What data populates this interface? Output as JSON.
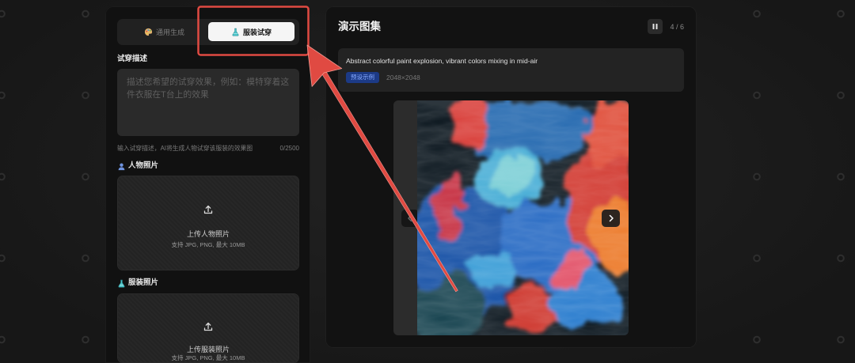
{
  "theme": {
    "annotation": "#e04a42"
  },
  "sidebar": {
    "tabs": [
      {
        "label": "通用生成",
        "icon": "palette-icon",
        "active": false
      },
      {
        "label": "服装试穿",
        "icon": "flask-icon",
        "active": true
      }
    ],
    "description": {
      "label": "试穿描述",
      "placeholder": "描述您希望的试穿效果，例如：模特穿着这件衣服在T台上的效果",
      "helper": "输入试穿描述，AI将生成人物试穿该服装的效果图",
      "counter": "0/2500"
    },
    "person_photo": {
      "label": "人物照片",
      "icon": "person-icon",
      "upload_icon": "upload-icon",
      "upload_title": "上传人物照片",
      "upload_hint": "支持 JPG, PNG, 最大 10MB"
    },
    "garment_photo": {
      "label": "服装照片",
      "icon": "flask-icon",
      "upload_icon": "upload-icon",
      "upload_title": "上传服装照片",
      "upload_hint": "支持 JPG, PNG, 最大 10MB"
    }
  },
  "gallery": {
    "title": "演示图集",
    "counter": "4 / 6",
    "pause_icon": "pause-icon",
    "prev_icon": "chevron-left-icon",
    "next_icon": "chevron-right-icon",
    "current": {
      "prompt": "Abstract colorful paint explosion, vibrant colors mixing in mid-air",
      "badge": "预设示例",
      "resolution": "2048×2048"
    }
  }
}
